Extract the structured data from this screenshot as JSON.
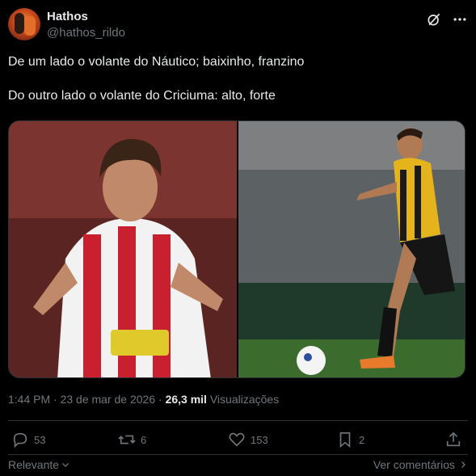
{
  "author": {
    "name": "Hathos",
    "handle": "@hathos_rildo"
  },
  "tweet": {
    "lines": [
      "De um lado o volante do Náutico; baixinho, franzino",
      "Do outro lado o volante do Criciuma: alto, forte"
    ]
  },
  "media": {
    "left_photo": "player-photo-nautico",
    "right_photo": "player-photo-criciuma"
  },
  "meta": {
    "time": "1:44 PM",
    "dot": " · ",
    "date": "23 de mar de 2026",
    "views_count": "26,3 mil",
    "views_label": "Visualizações"
  },
  "actions": {
    "replies": "53",
    "reposts": "6",
    "likes": "153",
    "bookmarks": "2"
  },
  "footer": {
    "sort_label": "Relevante",
    "more_replies": "Ver comentários"
  },
  "icons": {
    "grok": "grok-icon",
    "more": "more-icon",
    "reply": "reply-icon",
    "repost": "repost-icon",
    "like": "like-icon",
    "bookmark": "bookmark-icon",
    "share": "share-icon"
  },
  "colors": {
    "background": "#000000",
    "text": "#e7e9ea",
    "muted": "#71767b",
    "border": "#2f3336"
  }
}
